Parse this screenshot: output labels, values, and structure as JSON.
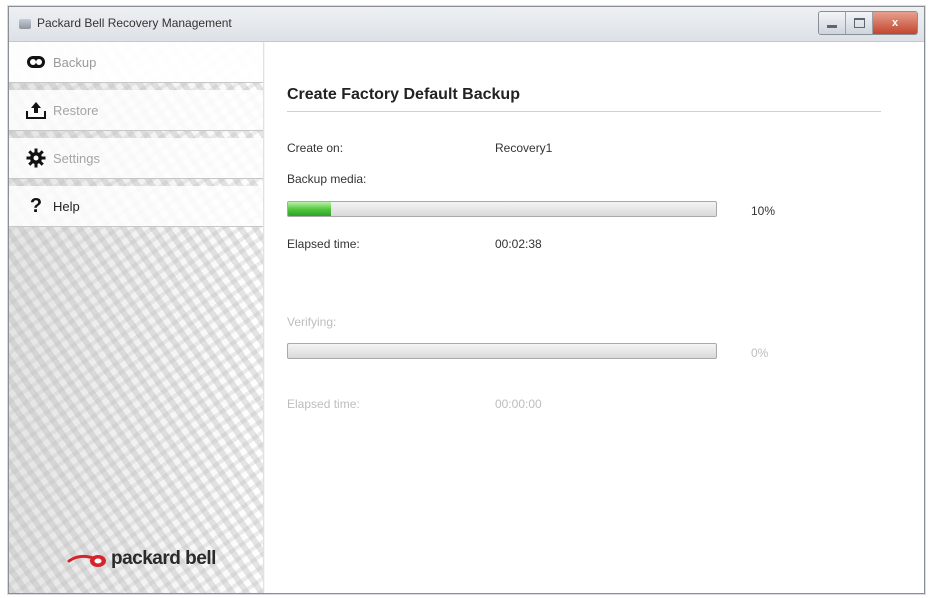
{
  "window": {
    "title": "Packard Bell Recovery Management",
    "close_glyph": "x"
  },
  "sidebar": {
    "items": [
      {
        "label": "Backup",
        "icon": "backup-icon"
      },
      {
        "label": "Restore",
        "icon": "restore-icon"
      },
      {
        "label": "Settings",
        "icon": "gear-icon"
      },
      {
        "label": "Help",
        "icon": "help-icon",
        "glyph": "?"
      }
    ],
    "logo_text": "packard bell"
  },
  "main": {
    "heading": "Create Factory Default Backup",
    "create_on_label": "Create on:",
    "create_on_value": "Recovery1",
    "backup_media_label": "Backup media:",
    "backup_progress": 0.1,
    "backup_percent": "10%",
    "elapsed_label": "Elapsed time:",
    "elapsed_value": "00:02:38",
    "verifying_label": "Verifying:",
    "verify_progress": 0.0,
    "verify_percent": "0%",
    "verify_elapsed_label": "Elapsed time:",
    "verify_elapsed_value": "00:00:00"
  },
  "colors": {
    "progress_green": "#4fc43a",
    "close_red": "#c2462d",
    "logo_red": "#d6242d"
  }
}
